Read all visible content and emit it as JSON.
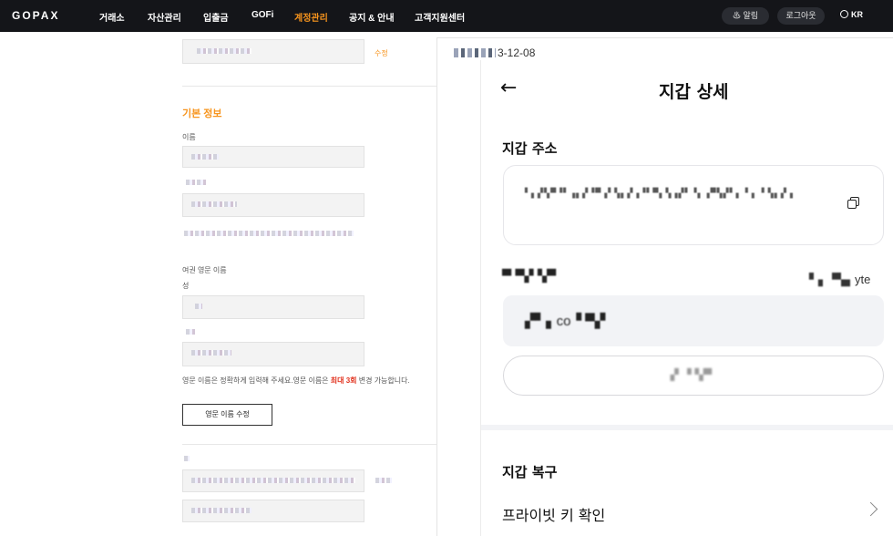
{
  "nav": {
    "logo": "GOPAX",
    "items": [
      "거래소",
      "자산관리",
      "입출금",
      "GOFi",
      "계정관리",
      "공지 & 안내",
      "고객지원센터"
    ],
    "active_index": 4,
    "alarm_label": "알림",
    "logout_label": "로그아웃",
    "lang_label": "KR"
  },
  "settings": {
    "edit_link": "수정",
    "basic_info_title": "기본 정보",
    "name_label": "이름",
    "passport_label": "여권 영문 이름",
    "surname_label": "성",
    "notice_pre": "영문 이름은 정확하게 입력해 주세요.영문 이름은 ",
    "notice_highlight": "최대 3회",
    "notice_post": " 변경 가능합니다.",
    "edit_en_name_button": "영문 이름 수정"
  },
  "wallet": {
    "date_suffix": "3-12-08",
    "title": "지갑 상세",
    "address_label": "지갑 주소",
    "network_suffix": "yte",
    "recovery_label": "지갑 복구",
    "private_key_label": "프라이빗 키 확인"
  },
  "colors": {
    "nav_bg": "#141519",
    "accent": "#f7941d",
    "highlight_red": "#e2331f"
  },
  "icons": [
    "back-arrow-icon",
    "copy-icon",
    "chevron-right-icon",
    "bell-icon",
    "globe-icon"
  ]
}
